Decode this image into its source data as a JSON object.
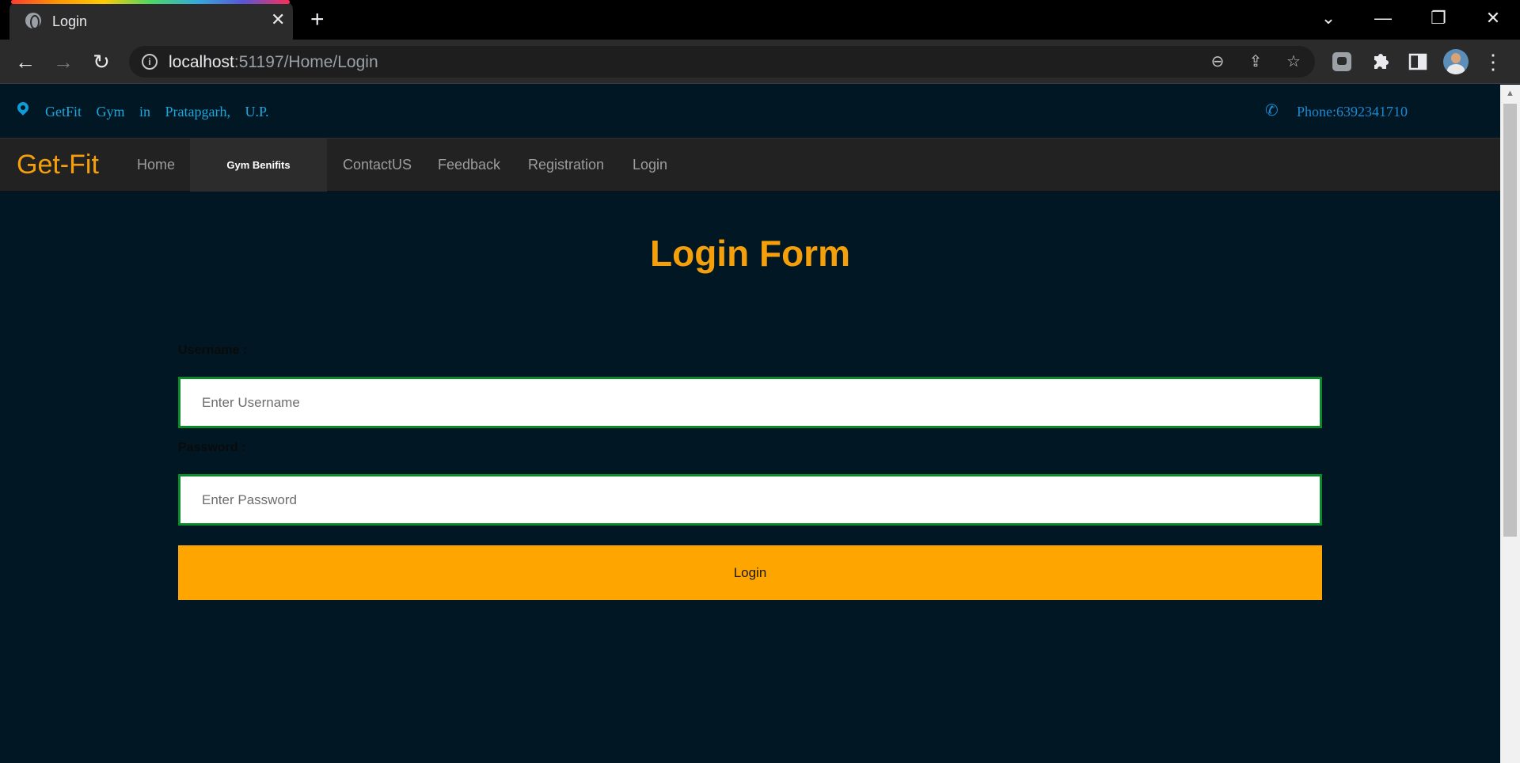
{
  "browser": {
    "tab_title": "Login",
    "url_host": "localhost",
    "url_rest": ":51197/Home/Login"
  },
  "topbar": {
    "location_text": "GetFit Gym in Pratapgarh, U.P.",
    "phone_text": "Phone:6392341710"
  },
  "navbar": {
    "brand": "Get-Fit",
    "items": [
      {
        "label": "Home"
      },
      {
        "label": "Gym Benifits",
        "active": true
      },
      {
        "label": "ContactUS"
      },
      {
        "label": "Feedback"
      },
      {
        "label": "Registration"
      },
      {
        "label": "Login"
      }
    ]
  },
  "form": {
    "title": "Login Form",
    "username_label": "Username :",
    "username_placeholder": "Enter Username",
    "password_label": "Password :",
    "password_placeholder": "Enter Password",
    "submit_label": "Login"
  },
  "colors": {
    "page_bg": "#011824",
    "accent": "#ffa500",
    "input_border": "#0b8a2a",
    "navbar_bg": "#222222",
    "info_text": "#1aa8e0"
  }
}
